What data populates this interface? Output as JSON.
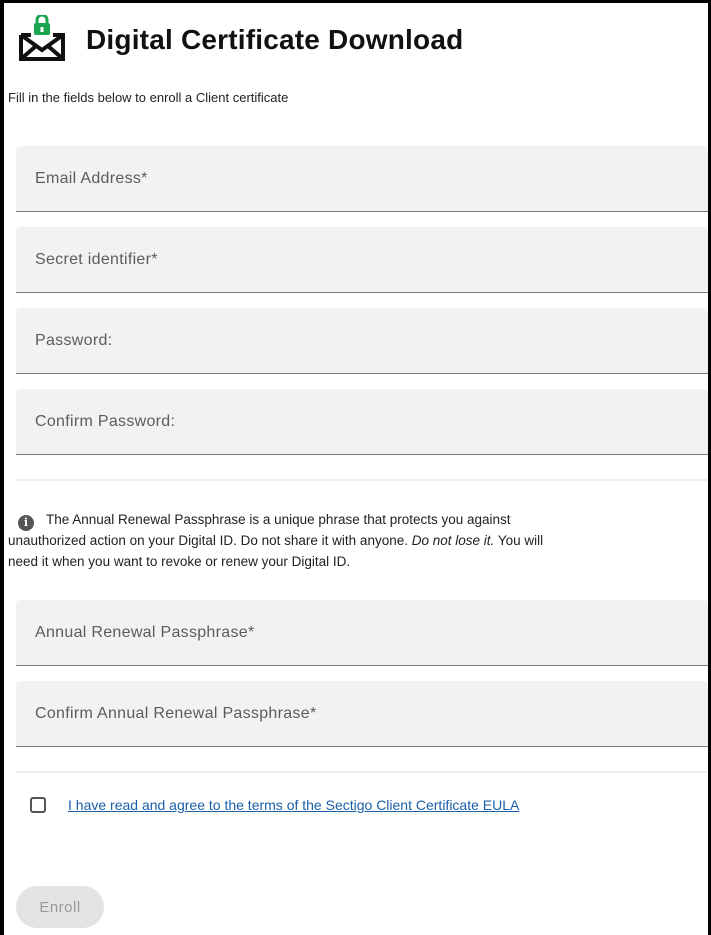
{
  "header": {
    "title": "Digital Certificate Download",
    "logo_icon": "envelope-lock-icon",
    "logo_accent_color": "#1aa551"
  },
  "subtitle": "Fill in the fields below to enroll a Client certificate",
  "fields": {
    "email": {
      "label": "Email Address",
      "required_mark": "*",
      "value": ""
    },
    "secret": {
      "label": "Secret identifier",
      "required_mark": "*",
      "value": ""
    },
    "password": {
      "label": "Password:",
      "value": ""
    },
    "confirm_password": {
      "label": "Confirm Password:",
      "value": ""
    },
    "passphrase": {
      "label": "Annual Renewal Passphrase",
      "required_mark": "*",
      "value": ""
    },
    "confirm_passphrase": {
      "label": "Confirm Annual Renewal Passphrase",
      "required_mark": "*",
      "value": ""
    }
  },
  "info": {
    "icon": "info-icon",
    "text_part1": "The Annual Renewal Passphrase is a unique phrase that protects you against",
    "text_part2": "unauthorized action on your Digital ID. Do not share it with anyone.",
    "text_emphasis": "Do not lose it.",
    "text_part3": "You will",
    "text_part4": "need it when you want to revoke or renew your Digital ID."
  },
  "eula": {
    "checked": false,
    "link_text": "I have read and agree to the terms of the Sectigo Client Certificate EULA"
  },
  "enroll_button": {
    "label": "Enroll",
    "enabled": false
  }
}
